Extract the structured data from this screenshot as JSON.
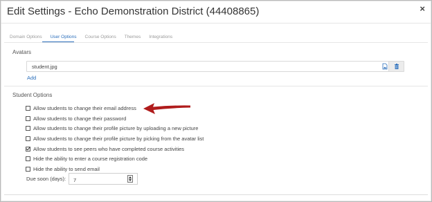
{
  "dialog": {
    "title": "Edit Settings - Echo Demonstration District (44408865)",
    "close_glyph": "×"
  },
  "tabs": [
    {
      "label": "Domain Options",
      "active": false
    },
    {
      "label": "User Options",
      "active": true
    },
    {
      "label": "Course Options",
      "active": false
    },
    {
      "label": "Themes",
      "active": false
    },
    {
      "label": "Integrations",
      "active": false
    }
  ],
  "avatars": {
    "heading": "Avatars",
    "file_name": "student.jpg",
    "file_icon": "image-file-icon",
    "delete_icon": "trash-icon",
    "add_label": "Add"
  },
  "student_options": {
    "heading": "Student Options",
    "items": [
      {
        "label": "Allow students to change their email address",
        "checked": false
      },
      {
        "label": "Allow students to change their password",
        "checked": false
      },
      {
        "label": "Allow students to change their profile picture by uploading a new picture",
        "checked": false
      },
      {
        "label": "Allow students to change their profile picture by picking from the avatar list",
        "checked": false
      },
      {
        "label": "Allow students to see peers who have completed course activities",
        "checked": true
      },
      {
        "label": "Hide the ability to enter a course registration code",
        "checked": false
      },
      {
        "label": "Hide the ability to send email",
        "checked": false
      }
    ],
    "due_soon_label": "Due soon (days):",
    "due_soon_value": "7"
  },
  "annotation": {
    "arrow_color": "#b01c1c"
  },
  "colors": {
    "link": "#2a6ebb",
    "active_tab": "#2a6ebb"
  }
}
